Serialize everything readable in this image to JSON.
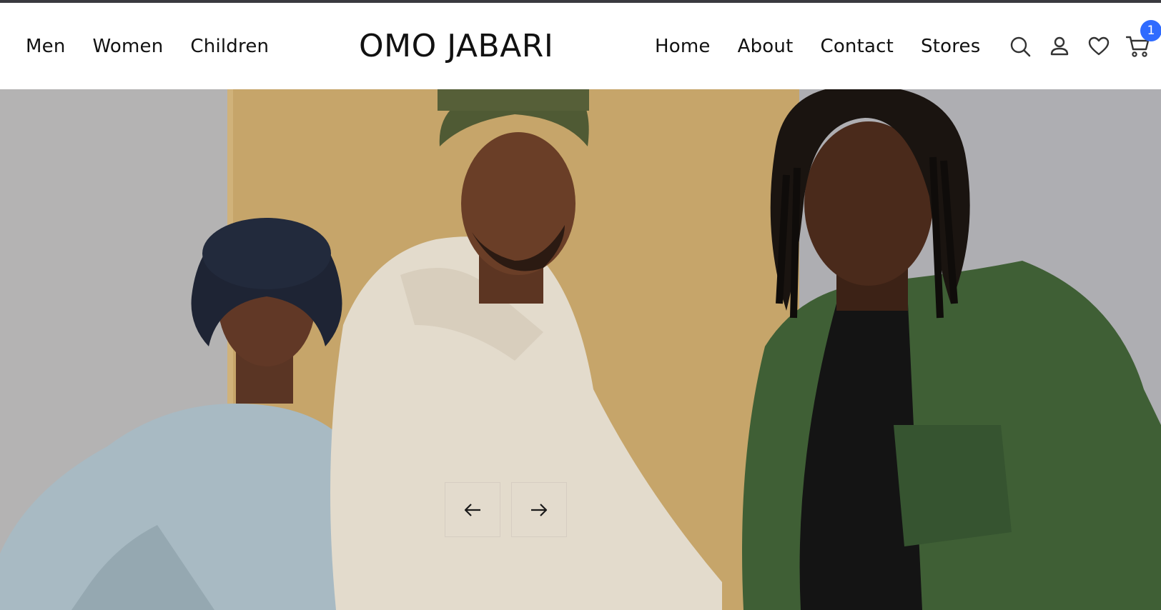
{
  "nav_left": [
    {
      "label": "Men"
    },
    {
      "label": "Women"
    },
    {
      "label": "Children"
    }
  ],
  "brand": {
    "name": "OMO JABARI"
  },
  "nav_right": [
    {
      "label": "Home"
    },
    {
      "label": "About"
    },
    {
      "label": "Contact"
    },
    {
      "label": "Stores"
    }
  ],
  "header_icons": {
    "search": "search-icon",
    "account": "user-icon",
    "wishlist": "heart-icon",
    "cart": "cart-icon",
    "cart_count": "1"
  },
  "hero": {
    "slider_prev_icon": "arrow-left-icon",
    "slider_next_icon": "arrow-right-icon"
  },
  "colors": {
    "badge": "#2f6bff",
    "text": "#111111",
    "top_strip": "#3a3a3f"
  }
}
